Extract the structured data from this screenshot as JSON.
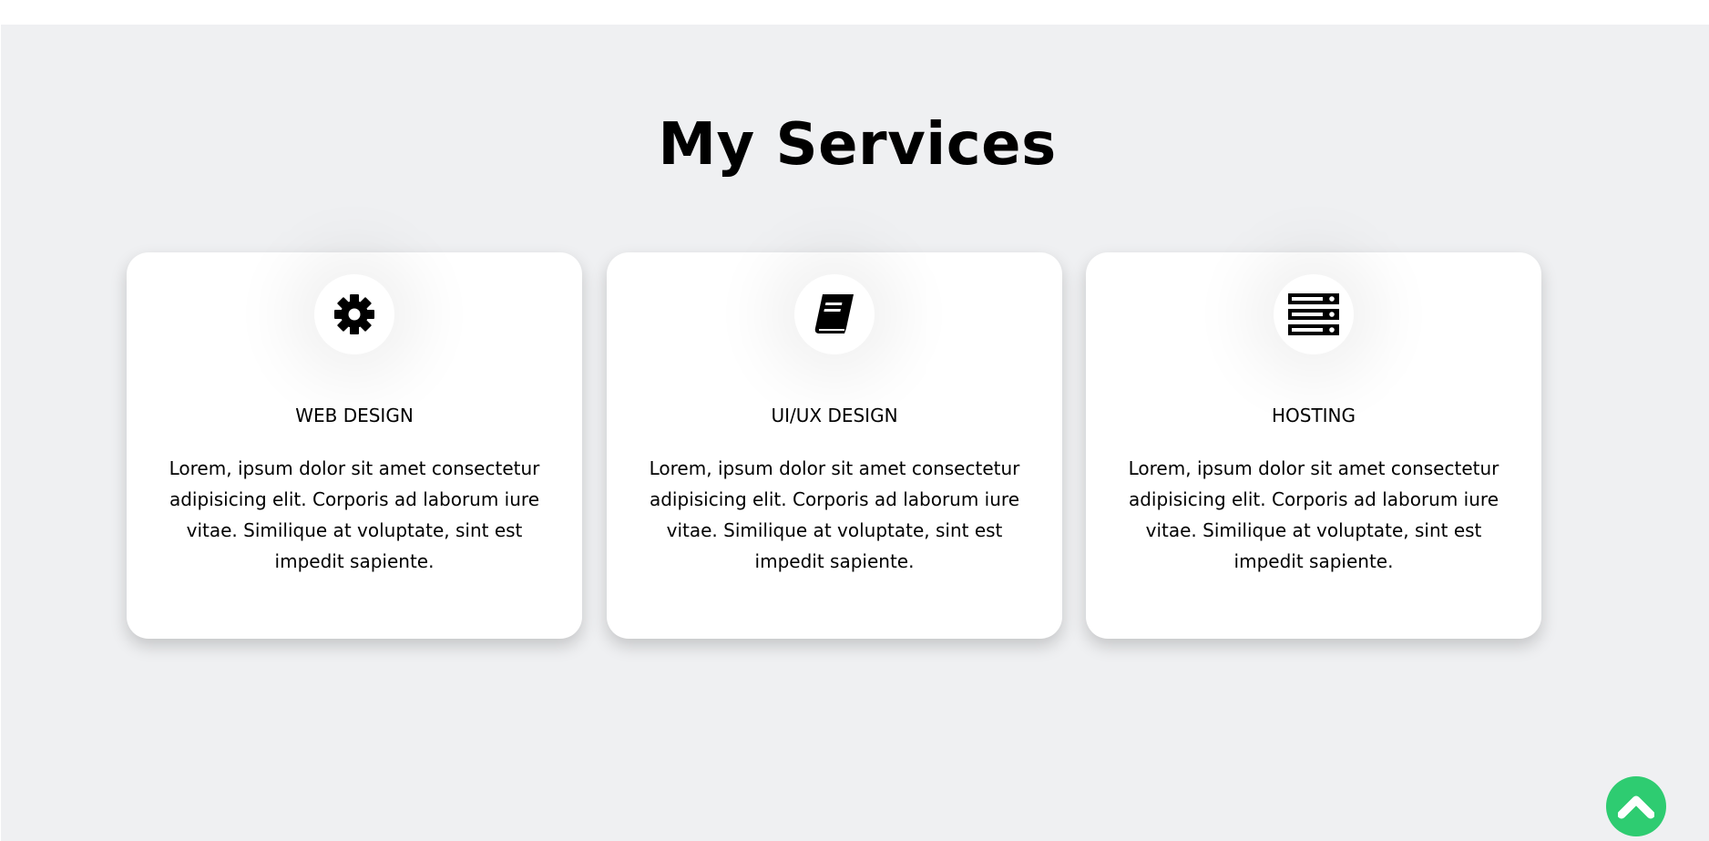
{
  "section": {
    "title": "My Services"
  },
  "cards": [
    {
      "icon": "gear-icon",
      "title": "WEB DESIGN",
      "text": "Lorem, ipsum dolor sit amet consectetur adipisicing elit. Corporis ad laborum iure vitae. Similique at voluptate, sint est impedit sapiente."
    },
    {
      "icon": "book-icon",
      "title": "UI/UX DESIGN",
      "text": "Lorem, ipsum dolor sit amet consectetur adipisicing elit. Corporis ad laborum iure vitae. Similique at voluptate, sint est impedit sapiente."
    },
    {
      "icon": "server-icon",
      "title": "HOSTING",
      "text": "Lorem, ipsum dolor sit amet consectetur adipisicing elit. Corporis ad laborum iure vitae. Similique at voluptate, sint est impedit sapiente."
    }
  ],
  "back_to_top": {
    "icon": "chevron-up-icon",
    "color": "#2ecc71"
  },
  "colors": {
    "section_background": "#eff0f2",
    "card_background": "#ffffff",
    "text": "#000000"
  }
}
